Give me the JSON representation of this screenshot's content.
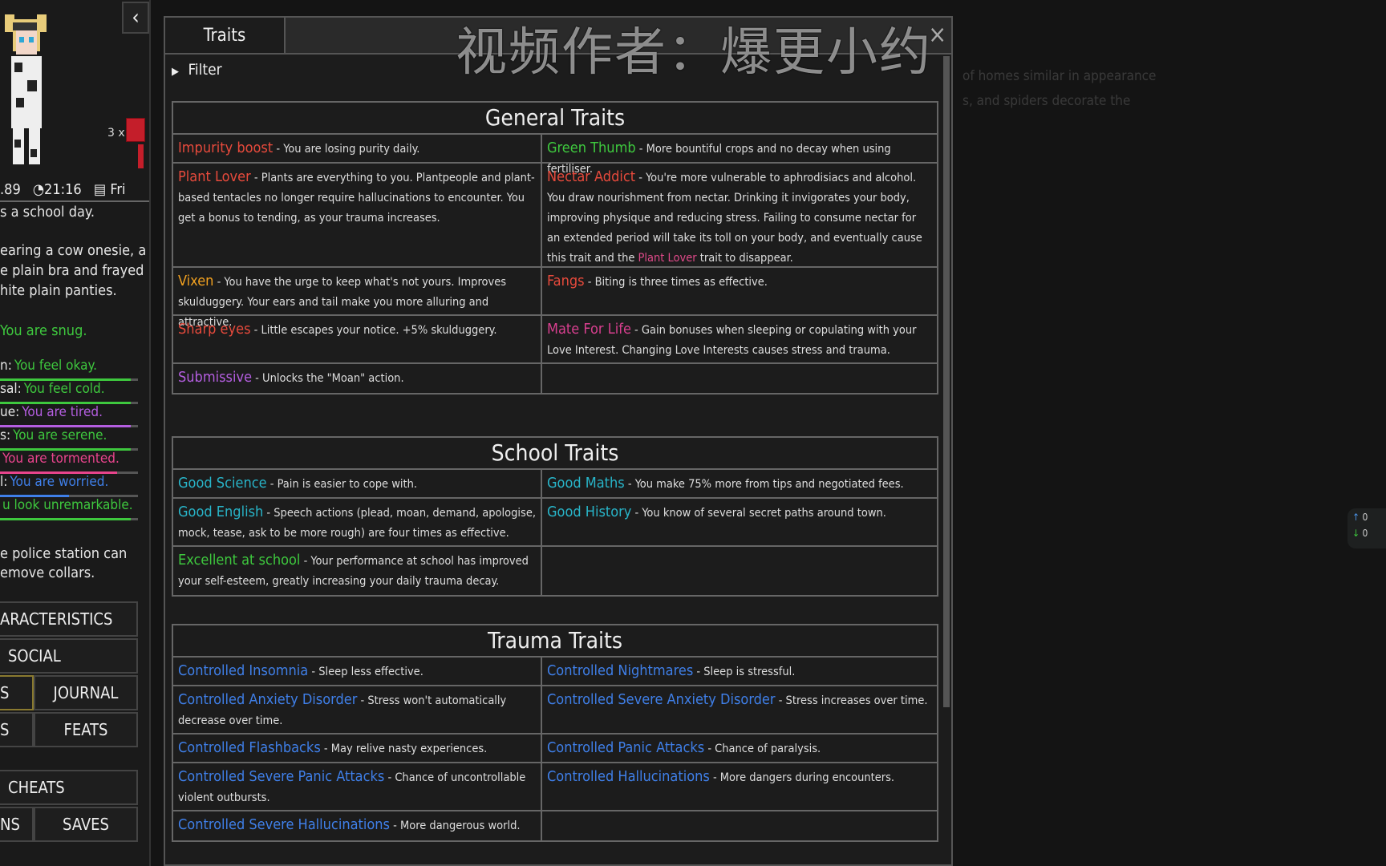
{
  "sidebar": {
    "collapse_icon": "chevron-left-icon",
    "collar_count": "3 x",
    "money": ".89",
    "time": "21:16",
    "day": "Fri",
    "school_day": "s a school day.",
    "clothing": [
      "earing a cow onesie, a",
      "e plain bra and frayed",
      "hite plain panties."
    ],
    "snug": "You are snug.",
    "meters": [
      {
        "label": "n:",
        "value": "You feel okay.",
        "color": "#3ec83e",
        "fill": 0.95
      },
      {
        "label": "sal:",
        "value": "You feel cold.",
        "color": "#3ec83e",
        "fill": 0.95
      },
      {
        "label": "ue:",
        "value": "You are tired.",
        "color": "#b45ee0",
        "fill": 0.95
      },
      {
        "label": "s:",
        "value": "You are serene.",
        "color": "#3ec83e",
        "fill": 0.95
      },
      {
        "label": "",
        "value": "You are tormented.",
        "color": "#e8448c",
        "fill": 0.85
      },
      {
        "label": "l:",
        "value": "You are worried.",
        "color": "#3f7fe8",
        "fill": 0.5
      },
      {
        "label": "",
        "value": "u look unremarkable.",
        "color": "#3ec83e",
        "fill": 0.95
      }
    ],
    "police_note": [
      "e police station can",
      "emove collars."
    ],
    "buttons": {
      "characteristics": "ARACTERISTICS",
      "social": "SOCIAL",
      "traits_partial": "S",
      "journal": "JOURNAL",
      "stats_partial": "S",
      "feats": "FEATS",
      "cheats": "CHEATS",
      "options_partial": "NS",
      "saves": "SAVES"
    }
  },
  "window": {
    "tab_label": "Traits",
    "close_icon": "×",
    "filter_label": "Filter",
    "watermark": "视频作者：爆更小约"
  },
  "sections": {
    "general": {
      "title": "General Traits",
      "traits": [
        {
          "name": "Impurity boost",
          "desc": " - You are losing purity daily."
        },
        {
          "name": "Green Thumb",
          "desc": " - More bountiful crops and no decay when using fertiliser."
        },
        {
          "name": "Plant Lover",
          "desc": " - Plants are everything to you. Plantpeople and plant-based tentacles no longer require hallucinations to encounter. You get a bonus to tending, as your trauma increases."
        },
        {
          "name": "Nectar Addict",
          "desc": " - You're more vulnerable to aphrodisiacs and alcohol. You draw nourishment from nectar. Drinking it invigorates your body, improving physique and reducing stress. Failing to consume nectar for an extended period will take its toll on your body, and eventually cause this trait and the ",
          "link": "Plant Lover",
          "tail": " trait to disappear."
        },
        {
          "name": "Vixen",
          "desc": " - You have the urge to keep what's not yours. Improves skulduggery. Your ears and tail make you more alluring and attractive."
        },
        {
          "name": "Fangs",
          "desc": " - Biting is three times as effective."
        },
        {
          "name": "Sharp eyes",
          "desc": " - Little escapes your notice. +5% skulduggery."
        },
        {
          "name": "Mate For Life",
          "desc": " - Gain bonuses when sleeping or copulating with your Love Interest. Changing Love Interests causes stress and trauma."
        },
        {
          "name": "Submissive",
          "desc": " - Unlocks the \"Moan\" action."
        }
      ]
    },
    "school": {
      "title": "School Traits",
      "traits": [
        {
          "name": "Good Science",
          "desc": " - Pain is easier to cope with."
        },
        {
          "name": "Good Maths",
          "desc": " - You make 75% more from tips and negotiated fees."
        },
        {
          "name": "Good English",
          "desc": " - Speech actions (plead, moan, demand, apologise, mock, tease, ask to be more rough) are four times as effective."
        },
        {
          "name": "Good History",
          "desc": " - You know of several secret paths around town."
        },
        {
          "name": "Excellent at school",
          "desc": " - Your performance at school has improved your self-esteem, greatly increasing your daily trauma decay."
        }
      ]
    },
    "trauma": {
      "title": "Trauma Traits",
      "traits": [
        {
          "name": "Controlled Insomnia",
          "desc": " - Sleep less effective."
        },
        {
          "name": "Controlled Nightmares",
          "desc": " - Sleep is stressful."
        },
        {
          "name": "Controlled Anxiety Disorder",
          "desc": " - Stress won't automatically decrease over time."
        },
        {
          "name": "Controlled Severe Anxiety Disorder",
          "desc": " - Stress increases over time."
        },
        {
          "name": "Controlled Flashbacks",
          "desc": " - May relive nasty experiences."
        },
        {
          "name": "Controlled Panic Attacks",
          "desc": " - Chance of paralysis."
        },
        {
          "name": "Controlled Severe Panic Attacks",
          "desc": " - Chance of uncontrollable violent outbursts."
        },
        {
          "name": "Controlled Hallucinations",
          "desc": " - More dangers during encounters."
        },
        {
          "name": "Controlled Severe Hallucinations",
          "desc": " - More dangerous world."
        }
      ]
    }
  },
  "background": {
    "lines": [
      "of homes similar in appearance",
      "s, and spiders decorate the"
    ]
  },
  "net_widget": {
    "up": "0",
    "down": "0"
  }
}
